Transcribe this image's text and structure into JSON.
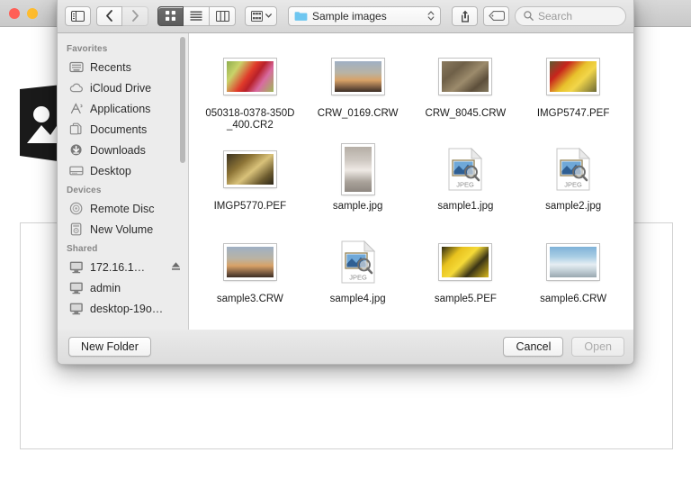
{
  "window": {
    "traffic_lights": [
      "close",
      "minimize"
    ],
    "background_app_icon": "photo-placeholder-icon"
  },
  "dialog": {
    "toolbar": {
      "sidebar_toggle": "sidebar-toggle-icon",
      "back_label": "Back",
      "forward_label": "Forward",
      "view_modes": [
        {
          "name": "icon-view",
          "selected": true
        },
        {
          "name": "list-view",
          "selected": false
        },
        {
          "name": "column-view",
          "selected": false
        }
      ],
      "arrange_label": "Arrange",
      "path_popup": {
        "label": "Sample images",
        "icon": "blue-folder-icon"
      },
      "share_label": "Share",
      "tags_label": "Tags",
      "search": {
        "placeholder": "Search",
        "value": ""
      }
    },
    "sidebar": {
      "sections": [
        {
          "header": "Favorites",
          "items": [
            {
              "label": "Recents",
              "icon": "recents-icon",
              "eject": false
            },
            {
              "label": "iCloud Drive",
              "icon": "icloud-icon",
              "eject": false
            },
            {
              "label": "Applications",
              "icon": "applications-icon",
              "eject": false
            },
            {
              "label": "Documents",
              "icon": "documents-icon",
              "eject": false
            },
            {
              "label": "Downloads",
              "icon": "downloads-icon",
              "eject": false
            },
            {
              "label": "Desktop",
              "icon": "desktop-icon",
              "eject": false
            }
          ]
        },
        {
          "header": "Devices",
          "items": [
            {
              "label": "Remote Disc",
              "icon": "remote-disc-icon",
              "eject": false
            },
            {
              "label": "New Volume",
              "icon": "hard-drive-icon",
              "eject": false
            }
          ]
        },
        {
          "header": "Shared",
          "items": [
            {
              "label": "172.16.1…",
              "icon": "computer-icon",
              "eject": true
            },
            {
              "label": "admin",
              "icon": "computer-icon",
              "eject": false
            },
            {
              "label": "desktop-19o…",
              "icon": "computer-icon",
              "eject": false
            }
          ]
        }
      ]
    },
    "files": [
      {
        "name": "050318-0378-350D_400.CR2",
        "kind": "photo",
        "thumb": "flowers-rose",
        "orientation": "landscape"
      },
      {
        "name": "CRW_0169.CRW",
        "kind": "photo",
        "thumb": "sunset-clouds",
        "orientation": "landscape"
      },
      {
        "name": "CRW_8045.CRW",
        "kind": "photo",
        "thumb": "brown-branches",
        "orientation": "landscape"
      },
      {
        "name": "IMGP5747.PEF",
        "kind": "photo",
        "thumb": "yellow-red-flower",
        "orientation": "landscape"
      },
      {
        "name": "IMGP5770.PEF",
        "kind": "photo",
        "thumb": "dark-gold-flower",
        "orientation": "landscape"
      },
      {
        "name": "sample.jpg",
        "kind": "photo",
        "thumb": "bathroom-interior",
        "orientation": "portrait"
      },
      {
        "name": "sample1.jpg",
        "kind": "jpeg-doc",
        "badge": "JPEG"
      },
      {
        "name": "sample2.jpg",
        "kind": "jpeg-doc",
        "badge": "JPEG"
      },
      {
        "name": "sample3.CRW",
        "kind": "photo",
        "thumb": "sunset-clouds",
        "orientation": "landscape"
      },
      {
        "name": "sample4.jpg",
        "kind": "jpeg-doc",
        "badge": "JPEG"
      },
      {
        "name": "sample5.PEF",
        "kind": "photo",
        "thumb": "yellow-leaves",
        "orientation": "landscape"
      },
      {
        "name": "sample6.CRW",
        "kind": "photo",
        "thumb": "snow-mountain",
        "orientation": "landscape"
      }
    ],
    "footer": {
      "new_folder_label": "New Folder",
      "cancel_label": "Cancel",
      "open_label": "Open",
      "open_disabled": true
    }
  },
  "colors": {
    "folder_blue": "#6ec6f0",
    "toolbar_top": "#e9e9e9",
    "sidebar_bg": "#ececec",
    "selected_view_mode": "#5c5c5c"
  }
}
